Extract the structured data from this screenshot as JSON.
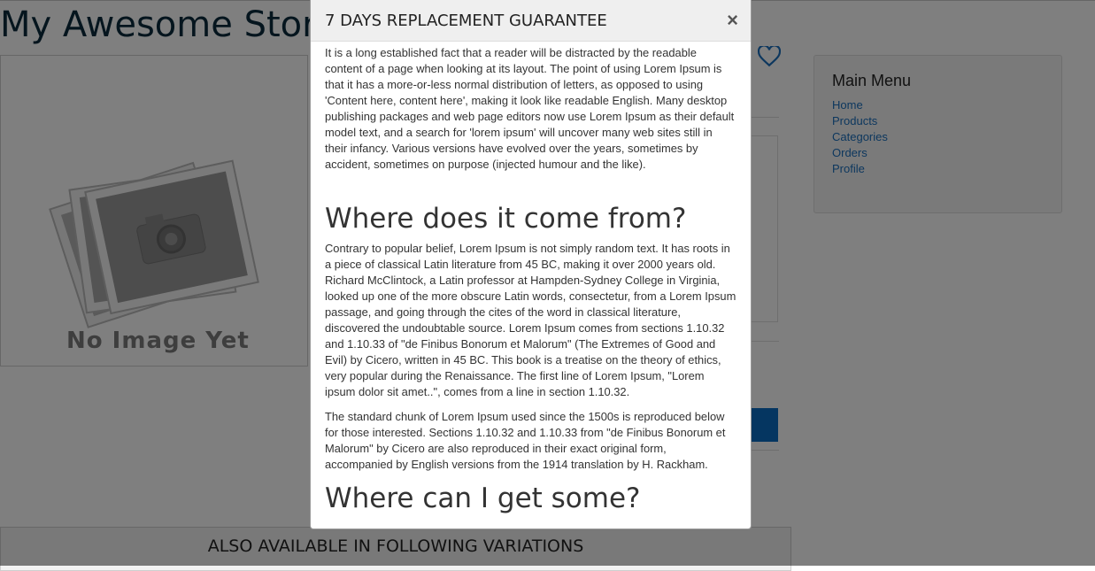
{
  "store": {
    "title": "My Awesome Store"
  },
  "product": {
    "no_image_text": "No Image Yet",
    "wishlist_icon": "heart-icon"
  },
  "main_menu": {
    "title": "Main Menu",
    "items": [
      "Home",
      "Products",
      "Categories",
      "Orders",
      "Profile"
    ]
  },
  "variations": {
    "heading": "ALSO AVAILABLE IN FOLLOWING VARIATIONS"
  },
  "modal": {
    "title": "7 DAYS REPLACEMENT GUARANTEE",
    "close_label": "×",
    "paragraph1": "It is a long established fact that a reader will be distracted by the readable content of a page when looking at its layout. The point of using Lorem Ipsum is that it has a more-or-less normal distribution of letters, as opposed to using 'Content here, content here', making it look like readable English. Many desktop publishing packages and web page editors now use Lorem Ipsum as their default model text, and a search for 'lorem ipsum' will uncover many web sites still in their infancy. Various versions have evolved over the years, sometimes by accident, sometimes on purpose (injected humour and the like).",
    "heading1": "Where does it come from?",
    "paragraph2": "Contrary to popular belief, Lorem Ipsum is not simply random text. It has roots in a piece of classical Latin literature from 45 BC, making it over 2000 years old. Richard McClintock, a Latin professor at Hampden-Sydney College in Virginia, looked up one of the more obscure Latin words, consectetur, from a Lorem Ipsum passage, and going through the cites of the word in classical literature, discovered the undoubtable source. Lorem Ipsum comes from sections 1.10.32 and 1.10.33 of \"de Finibus Bonorum et Malorum\" (The Extremes of Good and Evil) by Cicero, written in 45 BC. This book is a treatise on the theory of ethics, very popular during the Renaissance. The first line of Lorem Ipsum, \"Lorem ipsum dolor sit amet..\", comes from a line in section 1.10.32.",
    "paragraph3": "The standard chunk of Lorem Ipsum used since the 1500s is reproduced below for those interested. Sections 1.10.32 and 1.10.33 from \"de Finibus Bonorum et Malorum\" by Cicero are also reproduced in their exact original form, accompanied by English versions from the 1914 translation by H. Rackham.",
    "heading2": "Where can I get some?"
  },
  "colors": {
    "backdrop": "#000000",
    "link": "#1a6fbd",
    "primary_button": "#0a6dc2"
  }
}
